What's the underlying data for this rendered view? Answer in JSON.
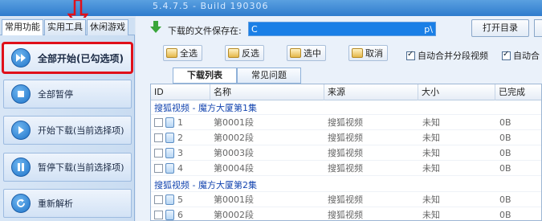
{
  "window": {
    "title": "5.4.7.5 - Build 190306"
  },
  "left_tabs": [
    "常用功能",
    "实用工具",
    "休闲游戏"
  ],
  "left_buttons": [
    {
      "label": "全部开始(已勾选项)",
      "icon": "double-play-icon"
    },
    {
      "label": "全部暂停",
      "icon": "stop-icon"
    },
    {
      "label": "开始下载(当前选择项)",
      "icon": "play-icon"
    },
    {
      "label": "暂停下载(当前选择项)",
      "icon": "pause-icon"
    },
    {
      "label": "重新解析",
      "icon": "refresh-icon"
    }
  ],
  "save": {
    "label": "下载的文件保存在:",
    "path_start": "C",
    "path_end": "p\\",
    "open_button": "打开目录"
  },
  "toolbar": {
    "select_all": "全选",
    "invert": "反选",
    "select": "选中",
    "cancel": "取消",
    "auto_merge_1": "自动合并分段视频",
    "auto_merge_2": "自动合"
  },
  "subtabs": [
    "下载列表",
    "常见问题"
  ],
  "columns": [
    "ID",
    "名称",
    "来源",
    "大小",
    "已完成"
  ],
  "groups": [
    {
      "title": "搜狐视频 - 魔方大厦第1集",
      "rows": [
        {
          "id": "1",
          "name": "第0001段",
          "source": "搜狐视频",
          "size": "未知",
          "done": "0B"
        },
        {
          "id": "2",
          "name": "第0002段",
          "source": "搜狐视频",
          "size": "未知",
          "done": "0B"
        },
        {
          "id": "3",
          "name": "第0003段",
          "source": "搜狐视频",
          "size": "未知",
          "done": "0B"
        },
        {
          "id": "4",
          "name": "第0004段",
          "source": "搜狐视频",
          "size": "未知",
          "done": "0B"
        }
      ]
    },
    {
      "title": "搜狐视频 - 魔方大厦第2集",
      "rows": [
        {
          "id": "5",
          "name": "第0001段",
          "source": "搜狐视频",
          "size": "未知",
          "done": "0B"
        },
        {
          "id": "6",
          "name": "第0002段",
          "source": "搜狐视频",
          "size": "未知",
          "done": "0B"
        }
      ]
    }
  ],
  "colors": {
    "highlight": "#e0101a",
    "accent": "#1f74c9",
    "group_text": "#1546b0"
  }
}
